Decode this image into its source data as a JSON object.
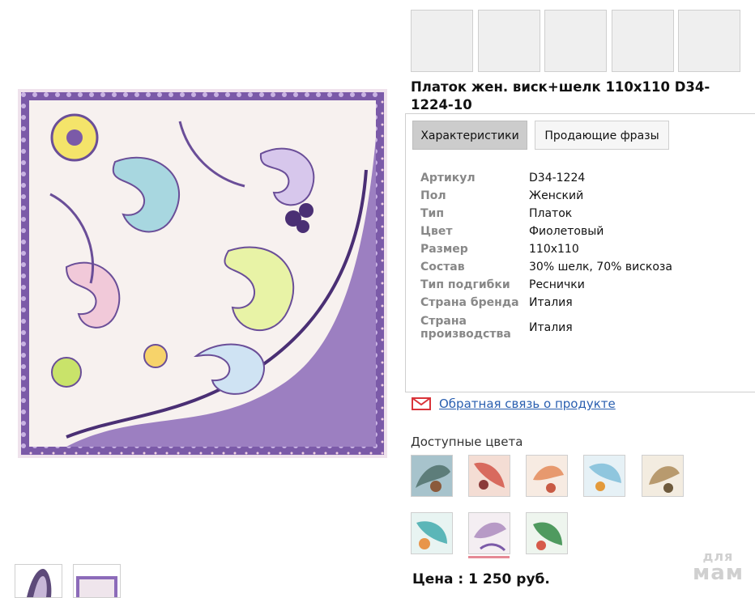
{
  "product": {
    "title": "Платок жен. виск+шелк 110х110 D34-1224-10"
  },
  "tabs": [
    {
      "label": "Характеристики",
      "active": true
    },
    {
      "label": "Продающие фразы",
      "active": false
    }
  ],
  "specs": [
    {
      "key": "Артикул",
      "value": "D34-1224"
    },
    {
      "key": "Пол",
      "value": "Женский"
    },
    {
      "key": "Тип",
      "value": "Платок"
    },
    {
      "key": "Цвет",
      "value": "Фиолетовый"
    },
    {
      "key": "Размер",
      "value": "110х110"
    },
    {
      "key": "Состав",
      "value": "30% шелк, 70% вискоза"
    },
    {
      "key": "Тип подгибки",
      "value": "Реснички"
    },
    {
      "key": "Страна бренда",
      "value": "Италия"
    },
    {
      "key": "Страна производства",
      "value": "Италия"
    }
  ],
  "feedback": {
    "label": "Обратная связь о продукте",
    "icon": "mail-icon"
  },
  "colors": {
    "title": "Доступные цвета",
    "swatches": [
      {
        "name": "teal-brown",
        "color": "#6f8f9a"
      },
      {
        "name": "coral-red",
        "color": "#d86a5e"
      },
      {
        "name": "peach-orange",
        "color": "#e7996e"
      },
      {
        "name": "sky-blue",
        "color": "#8fc6de"
      },
      {
        "name": "beige-brown",
        "color": "#b89a6e"
      },
      {
        "name": "turquoise-orange",
        "color": "#5bb6b8"
      },
      {
        "name": "lilac-selected",
        "color": "#b79ac6"
      },
      {
        "name": "green",
        "color": "#4f9a5f"
      }
    ],
    "selected_index": 6
  },
  "price": {
    "label": "Цена : 1 250 руб."
  },
  "watermark": {
    "line1": "для",
    "line2": "мам"
  },
  "palette": {
    "accent_tab_bg": "#cccccc",
    "link": "#2a5fb0",
    "selection_bar": "#e58a96",
    "scarf_border": "#7b5aa8",
    "scarf_base": "#f6f0ec"
  }
}
